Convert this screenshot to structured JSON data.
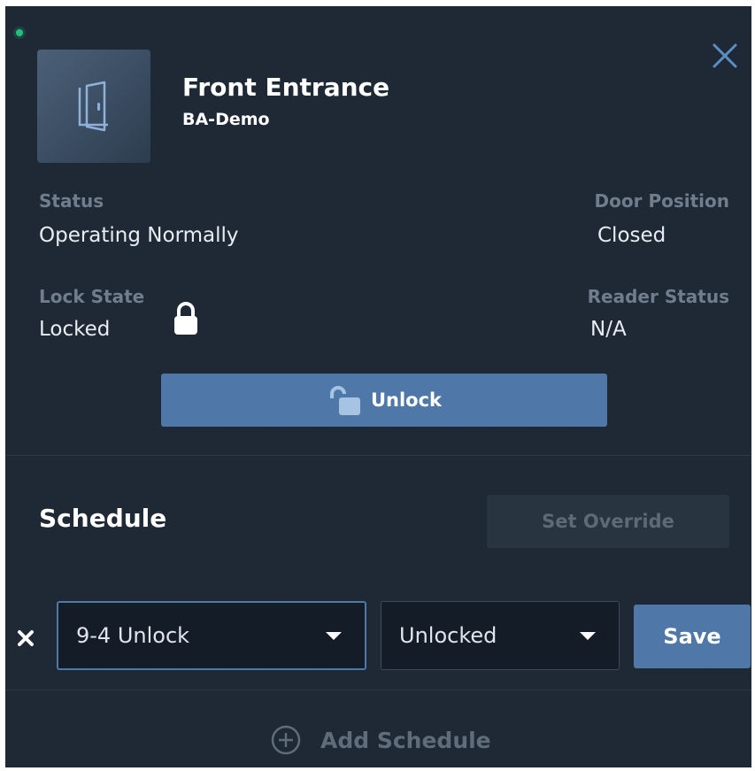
{
  "door": {
    "name": "Front Entrance",
    "site": "BA-Demo",
    "online_color": "#20c27a"
  },
  "status": {
    "label": "Status",
    "value": "Operating Normally"
  },
  "door_position": {
    "label": "Door Position",
    "value": "Closed"
  },
  "lock_state": {
    "label": "Lock State",
    "value": "Locked",
    "icon": "padlock-locked-icon"
  },
  "reader_status": {
    "label": "Reader Status",
    "value": "N/A"
  },
  "actions": {
    "unlock_label": "Unlock",
    "unlock_icon": "padlock-open-icon"
  },
  "schedule": {
    "title": "Schedule",
    "override_label": "Set Override",
    "rows": [
      {
        "schedule_value": "9-4 Unlock",
        "mode_value": "Unlocked",
        "save_label": "Save"
      }
    ],
    "add_label": "Add Schedule"
  },
  "colors": {
    "accent": "#4f78a8",
    "panel": "#1e2935"
  }
}
